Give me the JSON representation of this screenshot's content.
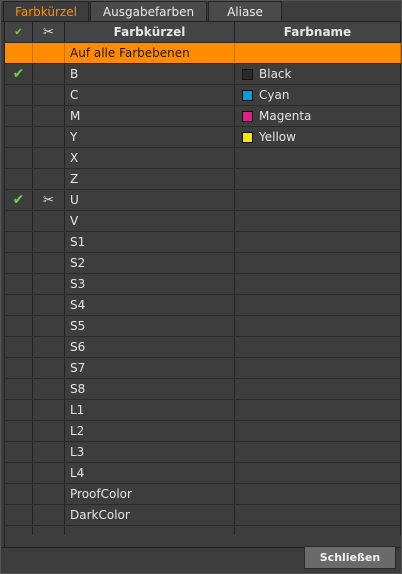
{
  "tabs": [
    {
      "label": "Farbkürzel",
      "active": true
    },
    {
      "label": "Ausgabefarben",
      "active": false
    },
    {
      "label": "Aliase",
      "active": false
    }
  ],
  "table": {
    "headers": {
      "col1_icon": "checkmark-icon",
      "col2_icon": "scissors-icon",
      "shortcode": "Farbkürzel",
      "colorname": "Farbname"
    },
    "all_row": "Auf alle Farbebenen",
    "rows": [
      {
        "checked": true,
        "cut": false,
        "code": "B",
        "name": "Black",
        "swatch": "#2b2b2b"
      },
      {
        "checked": false,
        "cut": false,
        "code": "C",
        "name": "Cyan",
        "swatch": "#00a0e0"
      },
      {
        "checked": false,
        "cut": false,
        "code": "M",
        "name": "Magenta",
        "swatch": "#e0208a"
      },
      {
        "checked": false,
        "cut": false,
        "code": "Y",
        "name": "Yellow",
        "swatch": "#f5e800"
      },
      {
        "checked": false,
        "cut": false,
        "code": "X",
        "name": "",
        "swatch": ""
      },
      {
        "checked": false,
        "cut": false,
        "code": "Z",
        "name": "",
        "swatch": ""
      },
      {
        "checked": true,
        "cut": true,
        "code": "U",
        "name": "",
        "swatch": ""
      },
      {
        "checked": false,
        "cut": false,
        "code": "V",
        "name": "",
        "swatch": ""
      },
      {
        "checked": false,
        "cut": false,
        "code": "S1",
        "name": "",
        "swatch": ""
      },
      {
        "checked": false,
        "cut": false,
        "code": "S2",
        "name": "",
        "swatch": ""
      },
      {
        "checked": false,
        "cut": false,
        "code": "S3",
        "name": "",
        "swatch": ""
      },
      {
        "checked": false,
        "cut": false,
        "code": "S4",
        "name": "",
        "swatch": ""
      },
      {
        "checked": false,
        "cut": false,
        "code": "S5",
        "name": "",
        "swatch": ""
      },
      {
        "checked": false,
        "cut": false,
        "code": "S6",
        "name": "",
        "swatch": ""
      },
      {
        "checked": false,
        "cut": false,
        "code": "S7",
        "name": "",
        "swatch": ""
      },
      {
        "checked": false,
        "cut": false,
        "code": "S8",
        "name": "",
        "swatch": ""
      },
      {
        "checked": false,
        "cut": false,
        "code": "L1",
        "name": "",
        "swatch": ""
      },
      {
        "checked": false,
        "cut": false,
        "code": "L2",
        "name": "",
        "swatch": ""
      },
      {
        "checked": false,
        "cut": false,
        "code": "L3",
        "name": "",
        "swatch": ""
      },
      {
        "checked": false,
        "cut": false,
        "code": "L4",
        "name": "",
        "swatch": ""
      },
      {
        "checked": false,
        "cut": false,
        "code": "ProofColor",
        "name": "",
        "swatch": ""
      },
      {
        "checked": false,
        "cut": false,
        "code": "DarkColor",
        "name": "",
        "swatch": ""
      }
    ]
  },
  "buttons": {
    "close": "Schließen"
  },
  "colors": {
    "accent": "#ff8c00",
    "check": "#6ed24a",
    "background": "#3d3d3d"
  }
}
